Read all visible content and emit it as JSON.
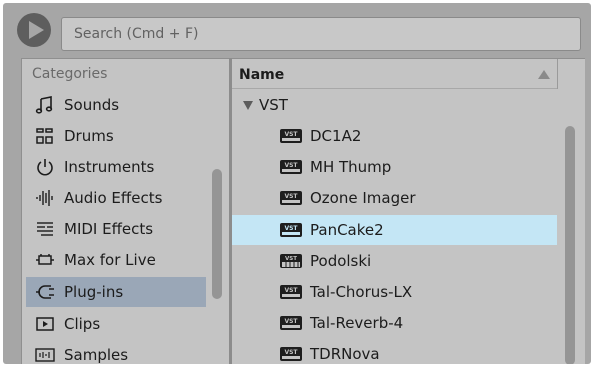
{
  "search": {
    "placeholder": "Search (Cmd + F)"
  },
  "categories": {
    "header": "Categories",
    "items": [
      {
        "label": "Sounds",
        "icon": "music-note-icon"
      },
      {
        "label": "Drums",
        "icon": "drum-grid-icon"
      },
      {
        "label": "Instruments",
        "icon": "power-icon"
      },
      {
        "label": "Audio Effects",
        "icon": "waveform-icon"
      },
      {
        "label": "MIDI Effects",
        "icon": "midi-effects-icon"
      },
      {
        "label": "Max for Live",
        "icon": "max-for-live-icon"
      },
      {
        "label": "Plug-ins",
        "icon": "plug-icon",
        "selected": true
      },
      {
        "label": "Clips",
        "icon": "clip-icon"
      },
      {
        "label": "Samples",
        "icon": "samples-icon"
      }
    ]
  },
  "list": {
    "column_name": "Name",
    "folder": "VST",
    "files": [
      {
        "label": "DC1A2",
        "icon": "vst-icon"
      },
      {
        "label": "MH Thump",
        "icon": "vst-icon"
      },
      {
        "label": "Ozone Imager",
        "icon": "vst-icon"
      },
      {
        "label": "PanCake2",
        "icon": "vst-icon",
        "selected": true
      },
      {
        "label": "Podolski",
        "icon": "vst-instrument-icon"
      },
      {
        "label": "Tal-Chorus-LX",
        "icon": "vst-icon"
      },
      {
        "label": "Tal-Reverb-4",
        "icon": "vst-icon"
      },
      {
        "label": "TDRNova",
        "icon": "vst-icon"
      }
    ]
  },
  "colors": {
    "background": "#a6a6a6",
    "panel": "#c4c4c4",
    "category_selected": "#9aa7b7",
    "file_selected": "#c4e6f5"
  }
}
